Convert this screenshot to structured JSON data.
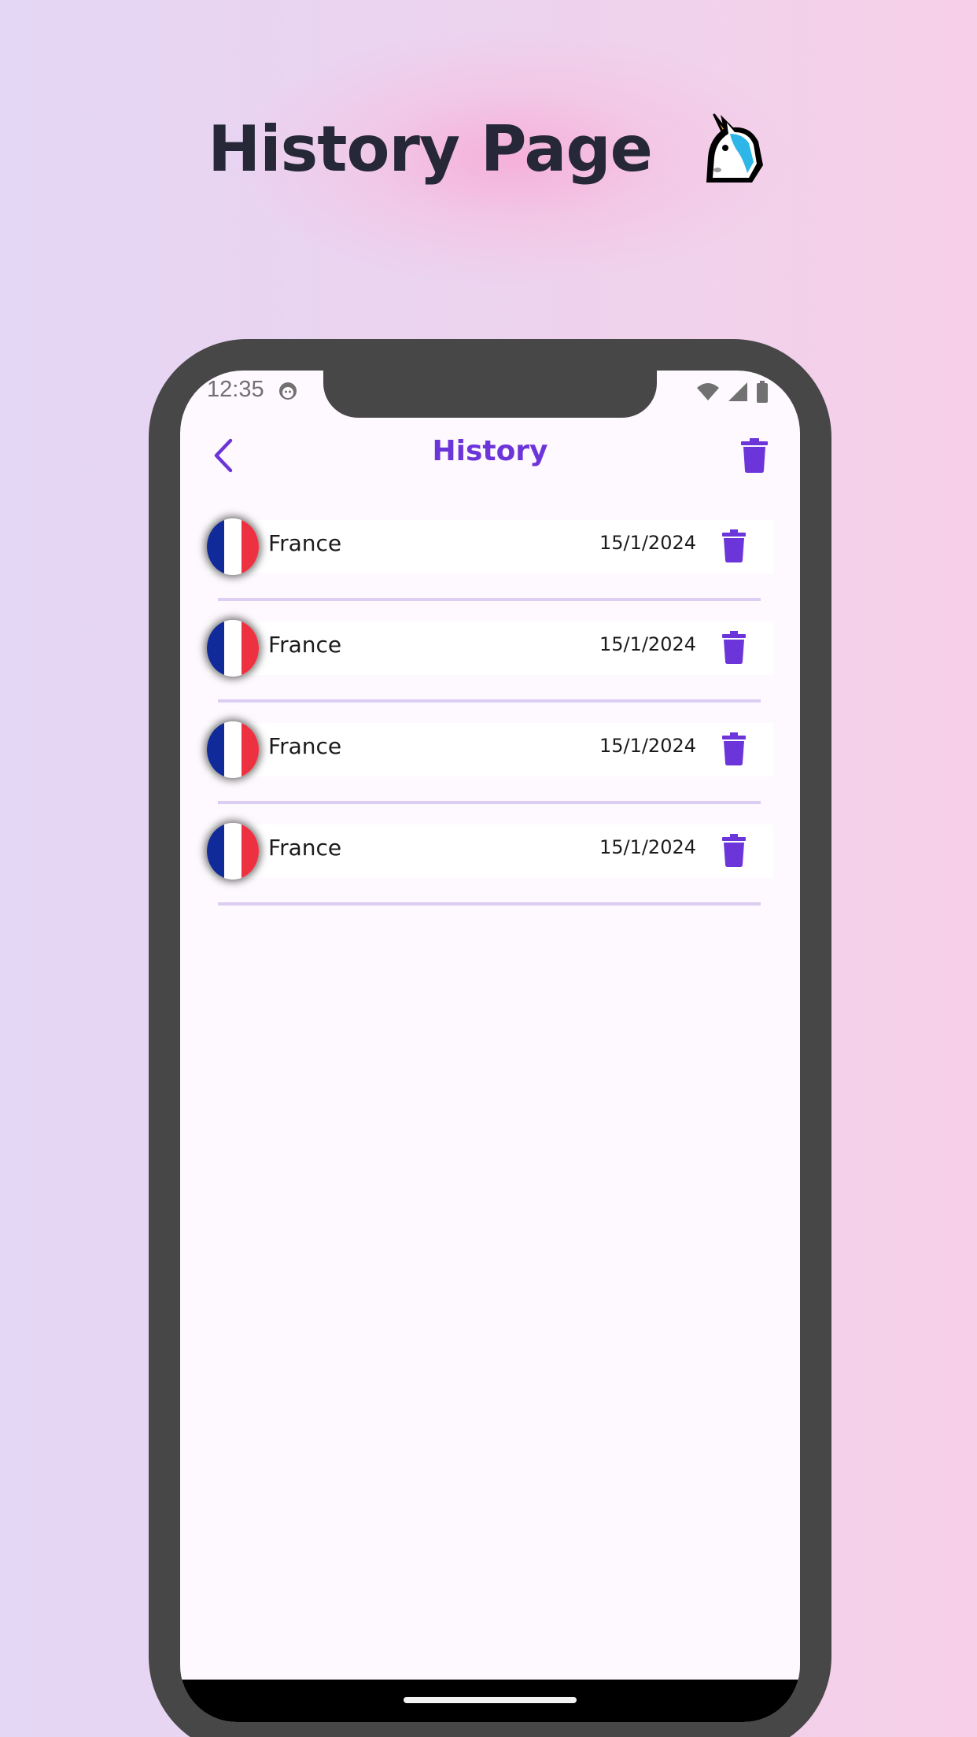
{
  "page": {
    "heading": "History Page",
    "heading_icon": "unicorn-icon"
  },
  "status_bar": {
    "time": "12:35",
    "icons": [
      "face-icon",
      "wifi-icon",
      "signal-icon",
      "battery-icon"
    ]
  },
  "app_bar": {
    "title": "History",
    "back_icon": "chevron-left-icon",
    "clear_icon": "trash-icon"
  },
  "history": {
    "items": [
      {
        "country": "France",
        "date": "15/1/2024",
        "flag": "france-flag"
      },
      {
        "country": "France",
        "date": "15/1/2024",
        "flag": "france-flag"
      },
      {
        "country": "France",
        "date": "15/1/2024",
        "flag": "france-flag"
      },
      {
        "country": "France",
        "date": "15/1/2024",
        "flag": "france-flag"
      }
    ]
  },
  "colors": {
    "accent": "#6c35d9",
    "frame": "#484748",
    "heading": "#262838",
    "divider": "#dccdf3"
  }
}
